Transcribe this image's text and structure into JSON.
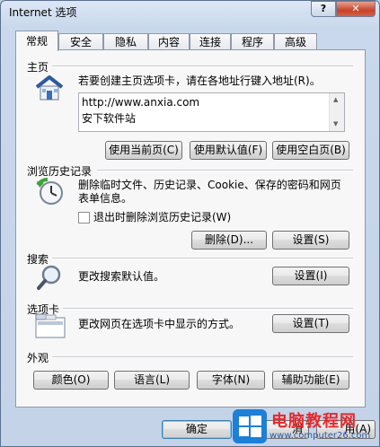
{
  "window": {
    "title": "Internet 选项",
    "help_glyph": "?",
    "close_glyph": "✕"
  },
  "tabs": [
    {
      "label": "常规"
    },
    {
      "label": "安全"
    },
    {
      "label": "隐私"
    },
    {
      "label": "内容"
    },
    {
      "label": "连接"
    },
    {
      "label": "程序"
    },
    {
      "label": "高级"
    }
  ],
  "homepage": {
    "title": "主页",
    "desc": "若要创建主页选项卡，请在各地址行键入地址(R)。",
    "lines": [
      "http://www.anxia.com",
      "安下软件站"
    ],
    "btn_current": "使用当前页(C)",
    "btn_default": "使用默认值(F)",
    "btn_blank": "使用空白页(B)"
  },
  "history": {
    "title": "浏览历史记录",
    "desc": "删除临时文件、历史记录、Cookie、保存的密码和网页表单信息。",
    "checkbox_label": "退出时删除浏览历史记录(W)",
    "btn_delete": "删除(D)...",
    "btn_settings": "设置(S)"
  },
  "search": {
    "title": "搜索",
    "desc": "更改搜索默认值。",
    "btn_settings": "设置(I)"
  },
  "tabs_section": {
    "title": "选项卡",
    "desc": "更改网页在选项卡中显示的方式。",
    "btn_settings": "设置(T)"
  },
  "appearance": {
    "title": "外观",
    "btn_colors": "颜色(O)",
    "btn_languages": "语言(L)",
    "btn_fonts": "字体(N)",
    "btn_accessibility": "辅助功能(E)"
  },
  "footer": {
    "btn_ok": "确定",
    "btn_cancel_partial": "消",
    "btn_apply_partial": "用(A)"
  },
  "watermark": {
    "text": "电脑教程网",
    "url": "www.computer26.com",
    "brand_red": "#e8272b",
    "brand_blue": "#2b5aa8"
  }
}
